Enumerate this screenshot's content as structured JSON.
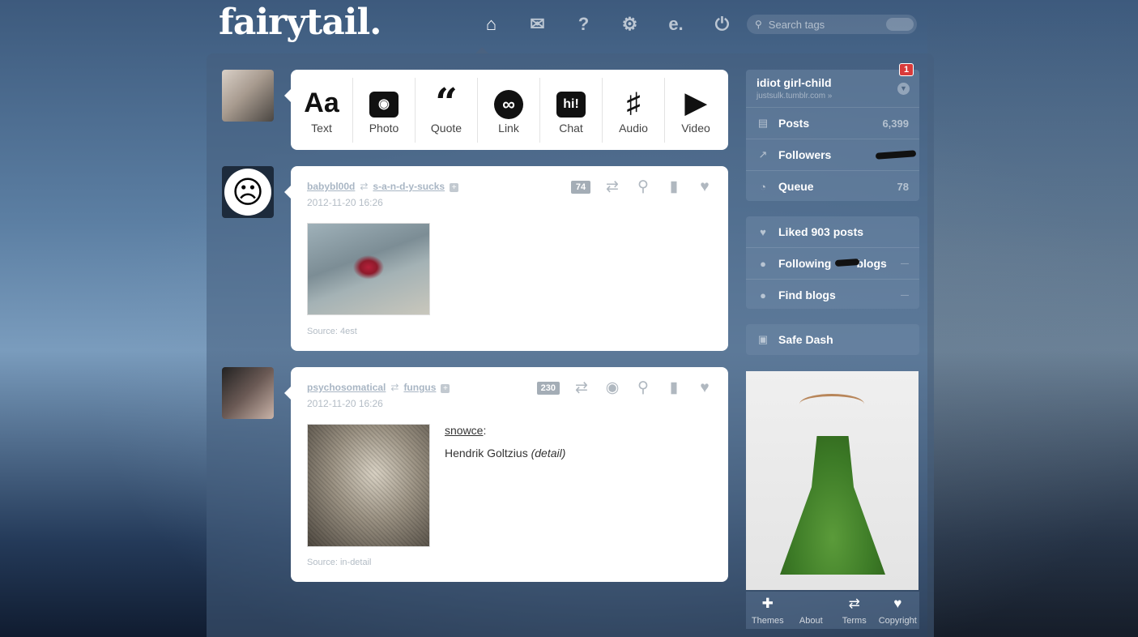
{
  "header": {
    "logo": "fairytail.",
    "nav": [
      {
        "icon": "home-icon",
        "glyph": "⌂"
      },
      {
        "icon": "mail-icon",
        "glyph": "✉"
      },
      {
        "icon": "help-icon",
        "glyph": "?"
      },
      {
        "icon": "gear-icon",
        "glyph": "⚙"
      },
      {
        "icon": "account-icon",
        "glyph": "e."
      },
      {
        "icon": "power-icon",
        "glyph": "⏻"
      }
    ],
    "search_placeholder": "Search tags"
  },
  "post_types": [
    {
      "label": "Text",
      "icon": "text-icon",
      "glyph": "Aa"
    },
    {
      "label": "Photo",
      "icon": "camera-icon",
      "glyph": "📷"
    },
    {
      "label": "Quote",
      "icon": "quote-icon",
      "glyph": "❝"
    },
    {
      "label": "Link",
      "icon": "link-icon",
      "glyph": "∞"
    },
    {
      "label": "Chat",
      "icon": "chat-icon",
      "glyph": "hi!"
    },
    {
      "label": "Audio",
      "icon": "headphones-icon",
      "glyph": "🎧"
    },
    {
      "label": "Video",
      "icon": "video-camera-icon",
      "glyph": "🎥"
    }
  ],
  "posts": [
    {
      "user": "babybl00d",
      "reblogged_from": "s-a-n-d-y-sucks",
      "date": "2012-11-20 16:26",
      "notes": "74",
      "source": "Source: 4est"
    },
    {
      "user": "psychosomatical",
      "reblogged_from": "fungus",
      "date": "2012-11-20 16:26",
      "notes": "230",
      "caption_user": "snowce",
      "caption_colon": ":",
      "caption_text": "Hendrik Goltzius ",
      "caption_detail": "(detail)",
      "source": "Source: in-detail"
    }
  ],
  "sidebar": {
    "badge": "1",
    "blog_name": "idiot girl-child",
    "blog_url": "justsulk.tumblr.com »",
    "stats": [
      {
        "label": "Posts",
        "count": "6,399",
        "icon": "document-icon",
        "glyph": "▤"
      },
      {
        "label": "Followers",
        "count": "",
        "icon": "chart-icon",
        "glyph": "⟋"
      },
      {
        "label": "Queue",
        "count": "78",
        "icon": "clock-icon",
        "glyph": "◔"
      }
    ],
    "social": [
      {
        "label": "Liked 903 posts",
        "icon": "heart-icon",
        "glyph": "♥"
      },
      {
        "label": "Following",
        "label2": "blogs",
        "icon": "person-icon",
        "glyph": "👤"
      },
      {
        "label": "Find blogs",
        "icon": "add-person-icon",
        "glyph": "👤"
      }
    ],
    "safe_dash": "Safe Dash"
  },
  "footer": [
    {
      "label": "Themes",
      "icon": "plus-icon",
      "glyph": "✚"
    },
    {
      "label": "About",
      "icon": "",
      "glyph": ""
    },
    {
      "label": "Terms",
      "icon": "reblog-icon",
      "glyph": "⇄"
    },
    {
      "label": "Copyright",
      "icon": "heart-icon",
      "glyph": "♥"
    }
  ]
}
